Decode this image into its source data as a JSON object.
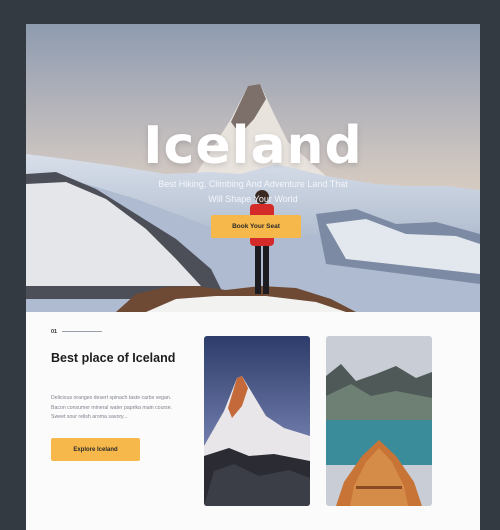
{
  "hero": {
    "title": "Iceland",
    "subtitle": "Best Hiking, Climbing And Adventure Land That Will Shape Your World",
    "cta_label": "Book Your Seat"
  },
  "feature": {
    "number": "01",
    "title": "Best place of Iceland",
    "body": "Delicious oranges desert spinach taste carbs vegan. Bacon consumer mineral water paprika main course. Sweet sour relish aroma savory...",
    "cta_label": "Explore Iceland"
  },
  "colors": {
    "backdrop": "#343a42",
    "accent": "#f7b84b",
    "hiker_jacket": "#d42a2a"
  },
  "icons": {
    "hero_image": "mountain-hiker-image",
    "card1_image": "matterhorn-peak-image",
    "card2_image": "lake-boat-image"
  }
}
